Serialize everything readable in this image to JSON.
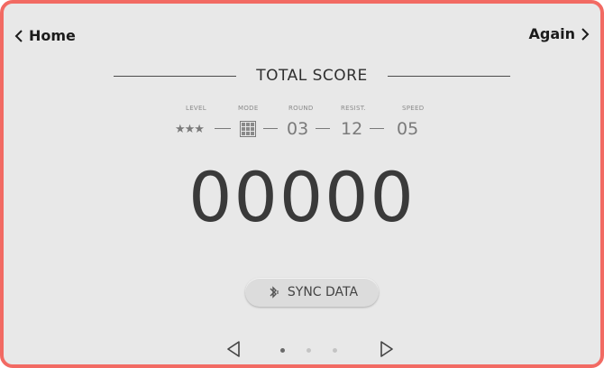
{
  "nav": {
    "home_label": "Home",
    "again_label": "Again"
  },
  "header": {
    "title": "TOTAL SCORE"
  },
  "stats": {
    "level": {
      "label": "LEVEL",
      "value": "★★★",
      "stars": 3
    },
    "mode": {
      "label": "MODE",
      "icon": "grid-mode-icon"
    },
    "round": {
      "label": "ROUND",
      "value": "03"
    },
    "resist": {
      "label": "RESIST.",
      "value": "12"
    },
    "speed": {
      "label": "SPEED",
      "value": "05"
    }
  },
  "score": {
    "value": "00000"
  },
  "sync": {
    "label": "SYNC DATA",
    "icon": "bluetooth-icon"
  },
  "pager": {
    "pages": 3,
    "active": 1,
    "prev_icon": "triangle-left-icon",
    "next_icon": "triangle-right-icon"
  },
  "colors": {
    "frame_border": "#f26a63",
    "background": "#e8e8e8",
    "text_dark": "#1c1c1c",
    "text_muted": "#7a7a7a"
  }
}
